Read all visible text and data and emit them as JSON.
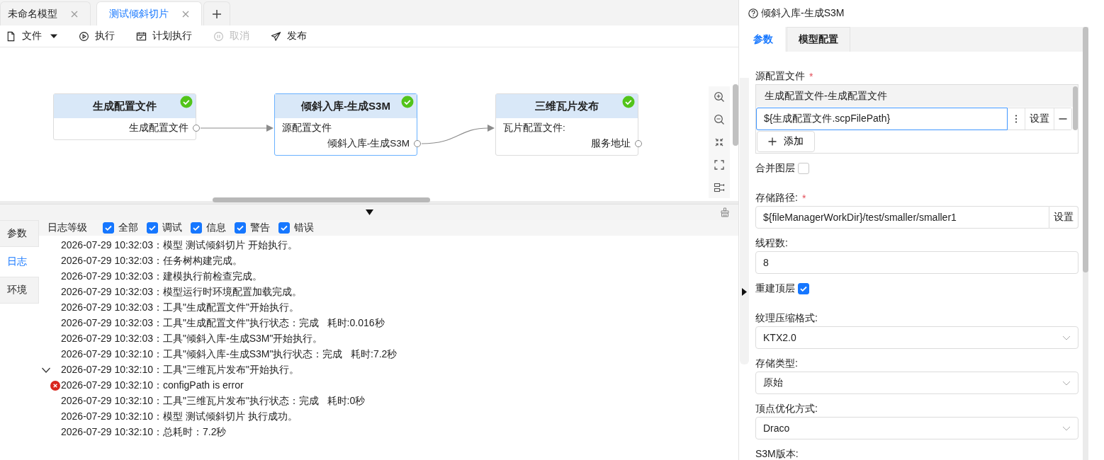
{
  "editor_tabs": [
    {
      "label": "未命名模型",
      "selected": false
    },
    {
      "label": "测试倾斜切片",
      "selected": true
    }
  ],
  "toolbar": [
    {
      "kind": "file",
      "label": "文件",
      "menu": true,
      "disabled": false
    },
    {
      "kind": "run",
      "label": "执行",
      "menu": false,
      "disabled": false
    },
    {
      "kind": "schedule",
      "label": "计划执行",
      "menu": false,
      "disabled": false
    },
    {
      "kind": "cancel",
      "label": "取消",
      "menu": false,
      "disabled": true
    },
    {
      "kind": "publish",
      "label": "发布",
      "menu": false,
      "disabled": false
    }
  ],
  "workflow": {
    "nodes": [
      {
        "title": "生成配置文件",
        "done": true,
        "selected": false,
        "connected_to_next": true,
        "ports": [
          {
            "kind": "output",
            "label": "生成配置文件"
          }
        ]
      },
      {
        "title": "倾斜入库-生成S3M",
        "done": true,
        "selected": true,
        "connected_to_next": true,
        "ports": [
          {
            "kind": "input",
            "label": "源配置文件"
          },
          {
            "kind": "output",
            "label": "倾斜入库-生成S3M"
          }
        ]
      },
      {
        "title": "三维瓦片发布",
        "done": true,
        "selected": false,
        "connected_to_next": false,
        "ports": [
          {
            "kind": "input",
            "label": "瓦片配置文件:"
          },
          {
            "kind": "output",
            "label": "服务地址"
          }
        ]
      }
    ]
  },
  "log_panel": {
    "side_tabs": [
      {
        "label": "参数",
        "selected": false
      },
      {
        "label": "日志",
        "selected": true
      },
      {
        "label": "环境",
        "selected": false
      }
    ],
    "level_label": "日志等级",
    "level_filters": [
      {
        "label": "全部",
        "checked": true
      },
      {
        "label": "调试",
        "checked": true
      },
      {
        "label": "信息",
        "checked": true
      },
      {
        "label": "警告",
        "checked": true
      },
      {
        "label": "错误",
        "checked": true
      }
    ],
    "entries": [
      {
        "error": false,
        "text": "2026-07-29 10:32:03：模型 测试倾斜切片 开始执行。"
      },
      {
        "error": false,
        "text": "2026-07-29 10:32:03：任务树构建完成。"
      },
      {
        "error": false,
        "text": "2026-07-29 10:32:03：建模执行前检查完成。"
      },
      {
        "error": false,
        "text": "2026-07-29 10:32:03：模型运行时环境配置加载完成。"
      },
      {
        "error": false,
        "text": "2026-07-29 10:32:03：工具\"生成配置文件\"开始执行。"
      },
      {
        "error": false,
        "text": "2026-07-29 10:32:03：工具\"生成配置文件\"执行状态：完成   耗时:0.016秒"
      },
      {
        "error": false,
        "text": "2026-07-29 10:32:03：工具\"倾斜入库-生成S3M\"开始执行。"
      },
      {
        "error": false,
        "text": "2026-07-29 10:32:10：工具\"倾斜入库-生成S3M\"执行状态：完成   耗时:7.2秒"
      },
      {
        "error": false,
        "expanded": true,
        "text": "2026-07-29 10:32:10：工具\"三维瓦片发布\"开始执行。"
      },
      {
        "error": true,
        "text": "2026-07-29 10:32:10：configPath is error"
      },
      {
        "error": false,
        "text": "2026-07-29 10:32:10：工具\"三维瓦片发布\"执行状态：完成   耗时:0秒"
      },
      {
        "error": false,
        "text": "2026-07-29 10:32:10：模型 测试倾斜切片 执行成功。"
      },
      {
        "error": false,
        "text": "2026-07-29 10:32:10：总耗时：7.2秒"
      }
    ]
  },
  "properties": {
    "title": "倾斜入库-生成S3M",
    "tabs": [
      {
        "label": "参数",
        "selected": true
      },
      {
        "label": "模型配置",
        "selected": false
      }
    ],
    "fields": [
      {
        "kind": "list",
        "label": "源配置文件",
        "required_mark": "*",
        "items": [
          {
            "source": "生成配置文件-生成配置文件",
            "value": "${生成配置文件.scpFilePath}",
            "button": "设置"
          }
        ],
        "add_label": "添加"
      },
      {
        "kind": "checkbox",
        "label": "合并图层",
        "checked": false
      },
      {
        "kind": "path",
        "label": "存储路径:",
        "required_mark": "*",
        "value": "${fileManagerWorkDir}/test/smaller/smaller1",
        "button": "设置"
      },
      {
        "kind": "input",
        "label": "线程数:",
        "value": "8"
      },
      {
        "kind": "checkbox",
        "label": "重建顶层",
        "checked": true
      },
      {
        "kind": "select",
        "label": "纹理压缩格式:",
        "value": "KTX2.0"
      },
      {
        "kind": "select",
        "label": "存储类型:",
        "value": "原始"
      },
      {
        "kind": "select",
        "label": "顶点优化方式:",
        "value": "Draco"
      },
      {
        "kind": "label",
        "label": "S3M版本:"
      }
    ]
  }
}
